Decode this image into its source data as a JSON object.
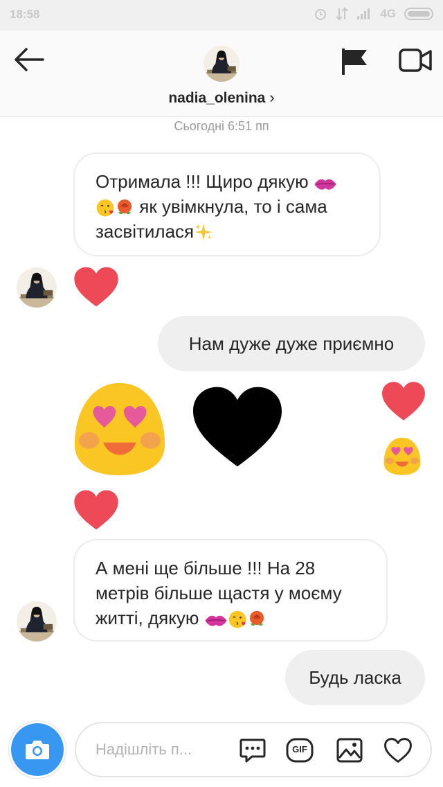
{
  "status_bar": {
    "time": "18:58",
    "network": "4G"
  },
  "header": {
    "username": "nadia_olenina",
    "chevron": "›",
    "back_icon": "arrow-left-icon",
    "flag_icon": "flag-icon",
    "video_icon": "video-camera-icon"
  },
  "thread": {
    "timestamp": "Сьогодні 6:51 пп",
    "messages": [
      {
        "from": "them",
        "lines": [
          "Отримала !!! Щиро дякую",
          "як увімкнула, то і сама",
          "засвітилася"
        ]
      },
      {
        "from": "them",
        "type": "reaction-heart"
      },
      {
        "from": "me",
        "text": "Нам дуже дуже приємно"
      },
      {
        "from": "me",
        "type": "big-emoji",
        "emojis": [
          "heart-eyes",
          "black-heart"
        ]
      },
      {
        "from": "me",
        "type": "small-emoji",
        "emojis": [
          "red-heart",
          "heart-eyes"
        ]
      },
      {
        "from": "them",
        "type": "reaction-heart"
      },
      {
        "from": "them",
        "lines": [
          "А мені ще більше !!! На 28",
          "метрів більше щастя у моєму",
          "житті, дякую"
        ]
      },
      {
        "from": "me",
        "text": "Будь ласка"
      }
    ]
  },
  "composer": {
    "placeholder": "Надішліть п...",
    "gif_label": "GIF",
    "camera_icon": "camera-icon",
    "tools": [
      "chat-bubble-icon",
      "gif-icon",
      "image-icon",
      "heart-icon"
    ]
  },
  "colors": {
    "accent": "#3897f0",
    "heart": "#ed4956",
    "bubble_out": "#efefef"
  }
}
